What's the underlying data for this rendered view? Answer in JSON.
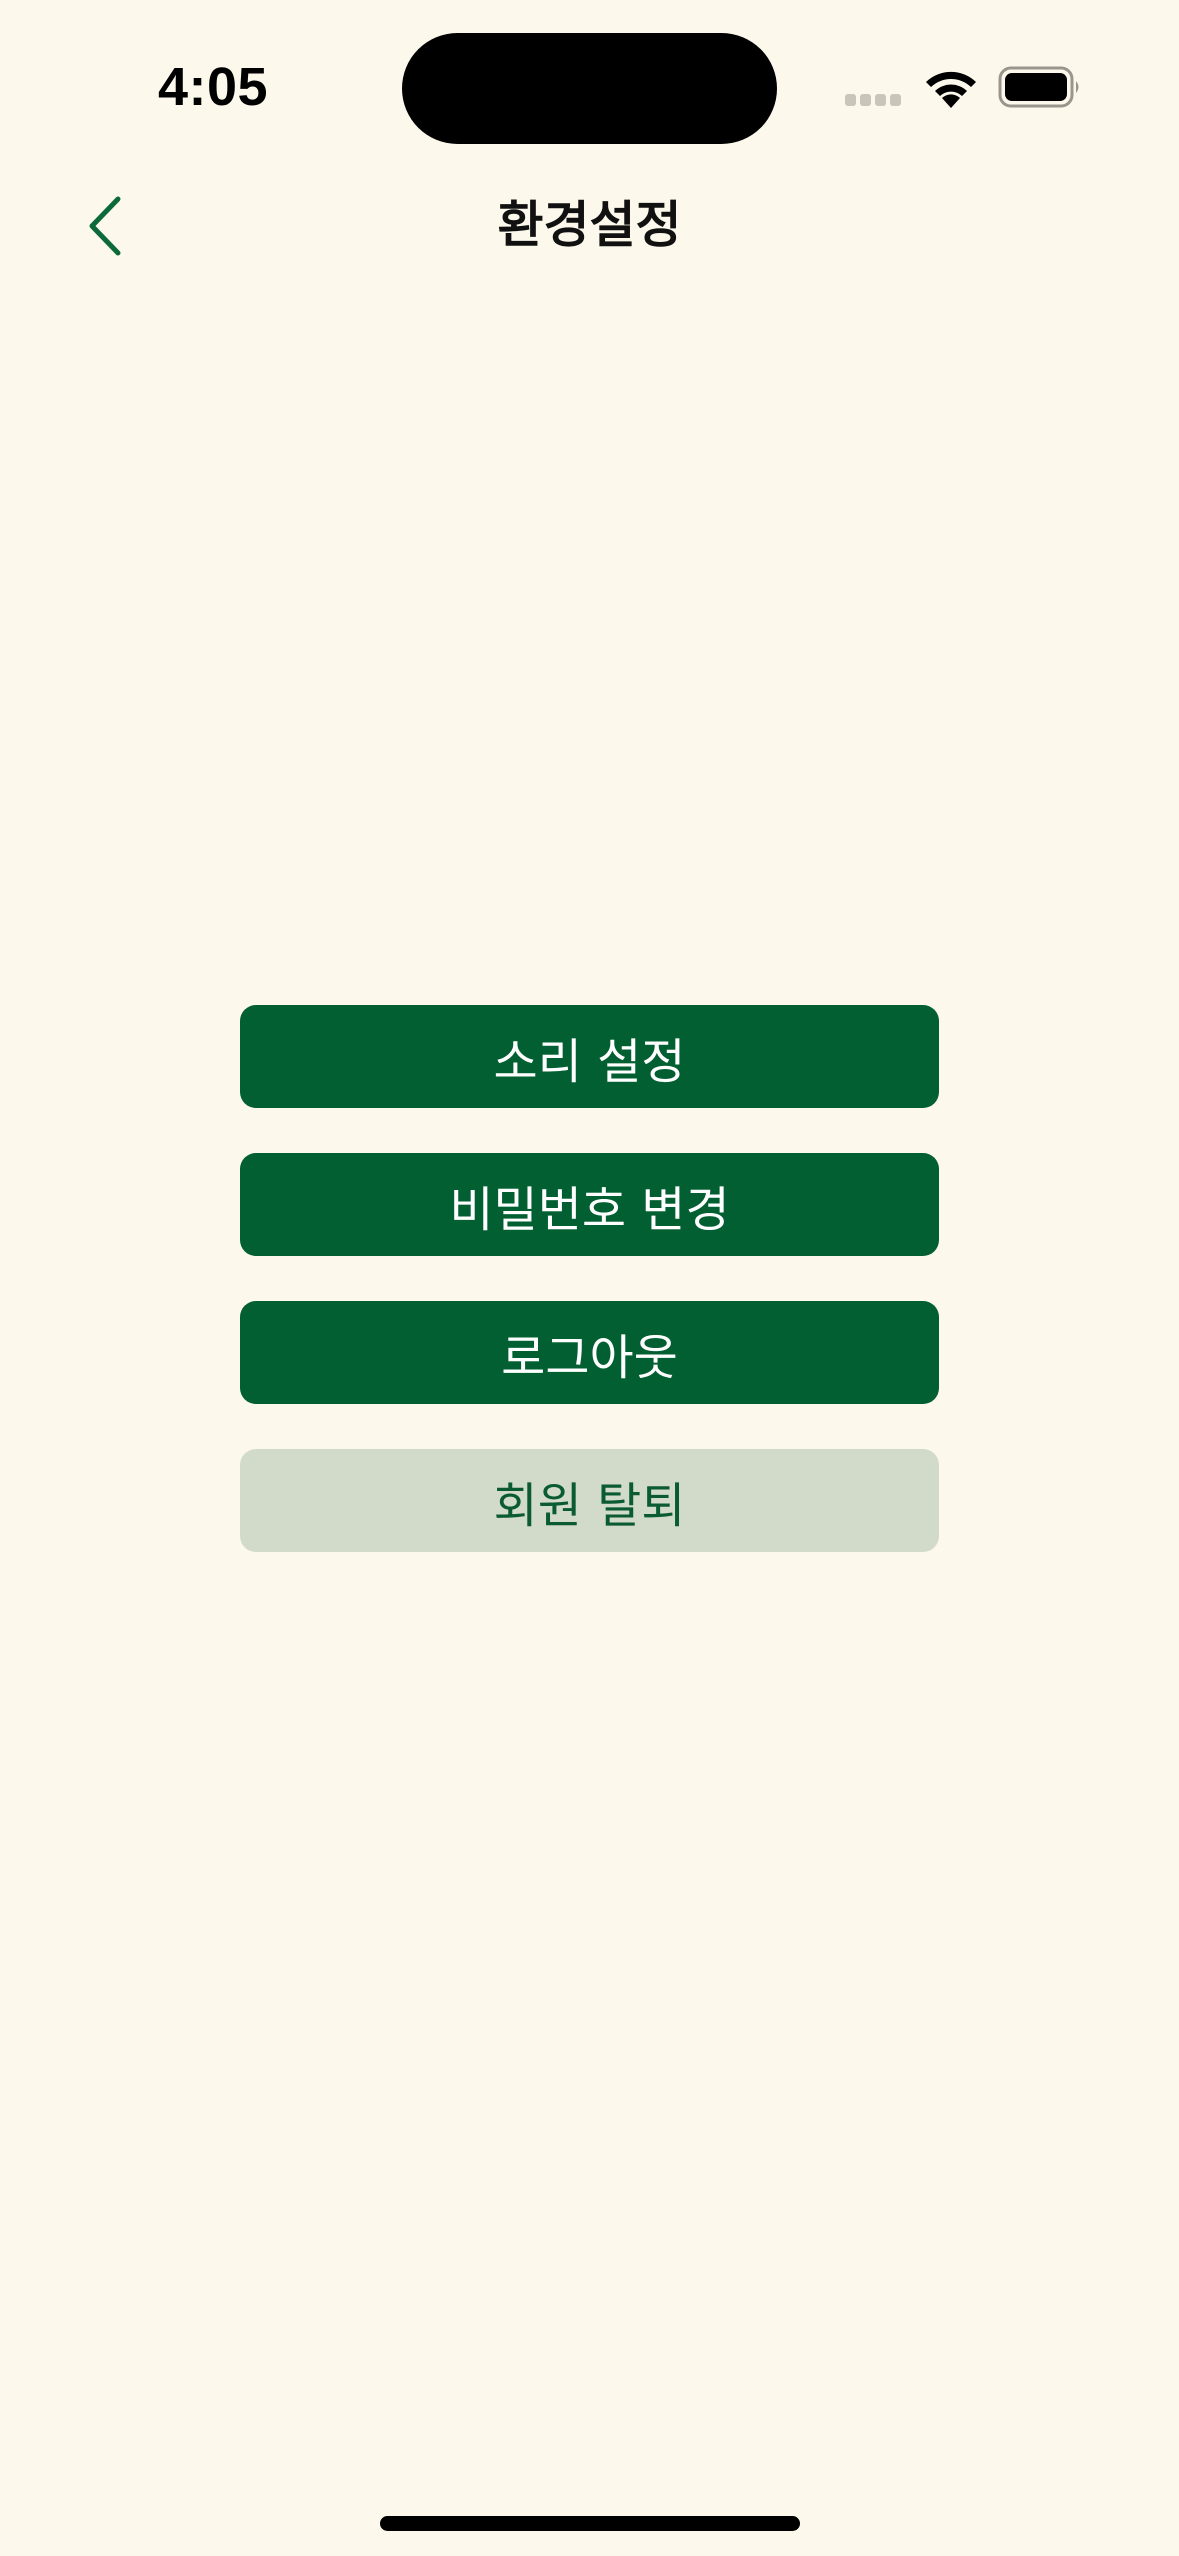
{
  "status_bar": {
    "time": "4:05",
    "icons": [
      "cellular-signal-icon",
      "wifi-icon",
      "battery-icon"
    ]
  },
  "nav": {
    "title": "환경설정",
    "back_icon": "chevron-left-icon"
  },
  "buttons": {
    "sound_settings": "소리 설정",
    "change_password": "비밀번호 변경",
    "logout": "로그아웃",
    "withdraw": "회원 탈퇴"
  },
  "colors": {
    "background": "#fcf8eb",
    "primary_green": "#025f31",
    "secondary_button": "#d2dbc9",
    "secondary_text": "#0b5b31"
  }
}
